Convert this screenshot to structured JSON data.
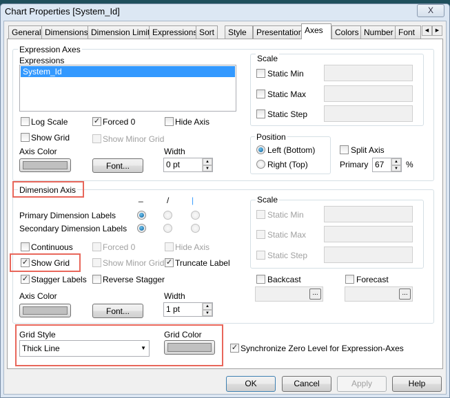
{
  "window": {
    "title": "Chart Properties [System_Id]",
    "close": "X"
  },
  "tabs": [
    "General",
    "Dimensions",
    "Dimension Limits",
    "Expressions",
    "Sort",
    "Style",
    "Presentation",
    "Axes",
    "Colors",
    "Number",
    "Font"
  ],
  "active_tab": "Axes",
  "expression_axes": {
    "group": "Expression Axes",
    "expressions_label": "Expressions",
    "expressions": [
      "System_Id"
    ],
    "log_scale": "Log Scale",
    "forced0": "Forced 0",
    "hide_axis": "Hide Axis",
    "show_grid": "Show Grid",
    "show_minor_grid": "Show Minor Grid",
    "axis_color": "Axis Color",
    "font_button": "Font...",
    "width_label": "Width",
    "width_value": "0 pt",
    "scale": {
      "group": "Scale",
      "static_min": "Static Min",
      "static_max": "Static Max",
      "static_step": "Static Step"
    },
    "position": {
      "group": "Position",
      "left": "Left (Bottom)",
      "right": "Right (Top)"
    },
    "split_axis": "Split Axis",
    "primary": "Primary",
    "primary_value": "67",
    "percent": "%"
  },
  "dimension_axis": {
    "group": "Dimension Axis",
    "orient_headers": [
      "_",
      "/",
      "|"
    ],
    "primary_labels": "Primary Dimension Labels",
    "secondary_labels": "Secondary Dimension Labels",
    "continuous": "Continuous",
    "forced0": "Forced 0",
    "hide_axis": "Hide Axis",
    "show_grid": "Show Grid",
    "show_minor_grid": "Show Minor Grid",
    "truncate_label": "Truncate Label",
    "stagger_labels": "Stagger Labels",
    "reverse_stagger": "Reverse Stagger",
    "axis_color": "Axis Color",
    "font_button": "Font...",
    "width_label": "Width",
    "width_value": "1 pt",
    "scale": {
      "group": "Scale",
      "static_min": "Static Min",
      "static_max": "Static Max",
      "static_step": "Static Step"
    },
    "backcast": "Backcast",
    "forecast": "Forecast",
    "ellipsis": "..."
  },
  "grid": {
    "style_label": "Grid Style",
    "style_value": "Thick Line",
    "color_label": "Grid Color",
    "sync": "Synchronize Zero Level for Expression-Axes"
  },
  "buttons": {
    "ok": "OK",
    "cancel": "Cancel",
    "apply": "Apply",
    "help": "Help"
  },
  "colors": {
    "highlight": "#e8665a",
    "selection": "#3399ff",
    "axis_color": "#c0c0c0"
  }
}
